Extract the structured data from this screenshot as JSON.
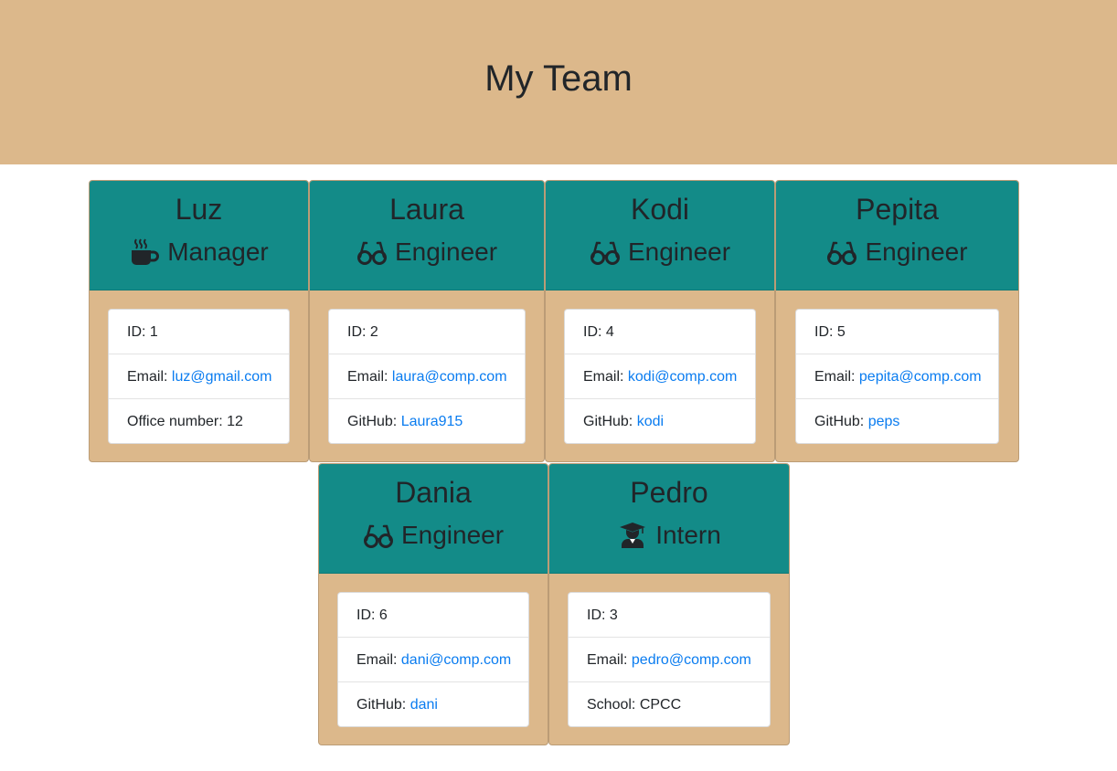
{
  "header": {
    "title": "My Team"
  },
  "team": [
    {
      "name": "Luz",
      "role": "Manager",
      "icon": "mug-icon",
      "id_label": "ID: ",
      "id": "1",
      "email_label": "Email: ",
      "email": "luz@gmail.com",
      "extra_label": "Office number: ",
      "extra_value": "12",
      "extra_is_link": false
    },
    {
      "name": "Laura",
      "role": "Engineer",
      "icon": "glasses-icon",
      "id_label": "ID: ",
      "id": "2",
      "email_label": "Email: ",
      "email": "laura@comp.com",
      "extra_label": "GitHub: ",
      "extra_value": "Laura915",
      "extra_is_link": true
    },
    {
      "name": "Kodi",
      "role": "Engineer",
      "icon": "glasses-icon",
      "id_label": "ID: ",
      "id": "4",
      "email_label": "Email: ",
      "email": "kodi@comp.com",
      "extra_label": "GitHub: ",
      "extra_value": "kodi",
      "extra_is_link": true
    },
    {
      "name": "Pepita",
      "role": "Engineer",
      "icon": "glasses-icon",
      "id_label": "ID: ",
      "id": "5",
      "email_label": "Email: ",
      "email": "pepita@comp.com",
      "extra_label": "GitHub: ",
      "extra_value": "peps",
      "extra_is_link": true
    },
    {
      "name": "Dania",
      "role": "Engineer",
      "icon": "glasses-icon",
      "id_label": "ID: ",
      "id": "6",
      "email_label": "Email: ",
      "email": "dani@comp.com",
      "extra_label": "GitHub: ",
      "extra_value": "dani",
      "extra_is_link": true
    },
    {
      "name": "Pedro",
      "role": "Intern",
      "icon": "graduate-icon",
      "id_label": "ID: ",
      "id": "3",
      "email_label": "Email: ",
      "email": "pedro@comp.com",
      "extra_label": "School: ",
      "extra_value": "CPCC",
      "extra_is_link": false
    }
  ],
  "colors": {
    "header_bg": "#dcb88b",
    "card_header_bg": "#138b88",
    "link": "#0a7cf0",
    "text": "#212529"
  }
}
